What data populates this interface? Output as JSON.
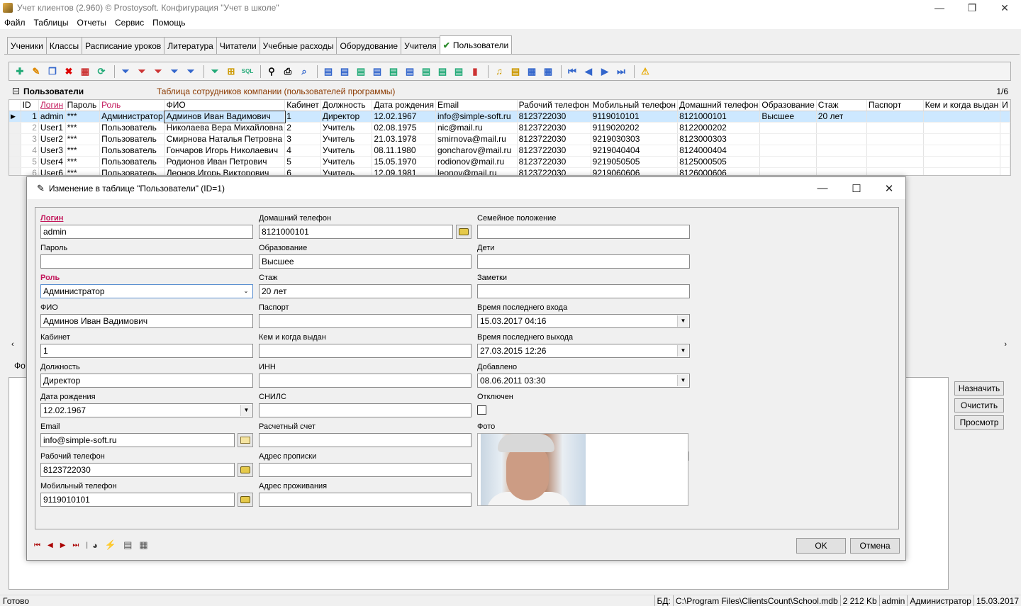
{
  "window": {
    "title": "Учет клиентов (2.960) © Prostoysoft. Конфигурация \"Учет в школе\"",
    "minimize": "—",
    "restore": "❐",
    "close": "✕"
  },
  "menu": [
    "Файл",
    "Таблицы",
    "Отчеты",
    "Сервис",
    "Помощь"
  ],
  "tabs": [
    "Ученики",
    "Классы",
    "Расписание уроков",
    "Литература",
    "Читатели",
    "Учебные расходы",
    "Оборудование",
    "Учителя",
    "Пользователи"
  ],
  "active_tab": "Пользователи",
  "grid": {
    "title": "Пользователи",
    "description": "Таблица сотрудников компании (пользователей программы)",
    "count": "1/6",
    "columns": [
      "ID",
      "Логин",
      "Пароль",
      "Роль",
      "ФИО",
      "Кабинет",
      "Должность",
      "Дата рождения",
      "Email",
      "Рабочий телефон",
      "Мобильный телефон",
      "Домашний телефон",
      "Образование",
      "Стаж",
      "Паспорт",
      "Кем и когда выдан",
      "И"
    ],
    "rows": [
      [
        "1",
        "admin",
        "***",
        "Администратор",
        "Админов Иван Вадимович",
        "1",
        "Директор",
        "12.02.1967",
        "info@simple-soft.ru",
        "8123722030",
        "9119010101",
        "8121000101",
        "Высшее",
        "20 лет",
        "",
        "",
        ""
      ],
      [
        "2",
        "User1",
        "***",
        "Пользователь",
        "Николаева Вера Михайловна",
        "2",
        "Учитель",
        "02.08.1975",
        "nic@mail.ru",
        "8123722030",
        "9119020202",
        "8122000202",
        "",
        "",
        "",
        "",
        ""
      ],
      [
        "3",
        "User2",
        "***",
        "Пользователь",
        "Смирнова Наталья Петровна",
        "3",
        "Учитель",
        "21.03.1978",
        "smirnova@mail.ru",
        "8123722030",
        "9219030303",
        "8123000303",
        "",
        "",
        "",
        "",
        ""
      ],
      [
        "4",
        "User3",
        "***",
        "Пользователь",
        "Гончаров Игорь Николаевич",
        "4",
        "Учитель",
        "08.11.1980",
        "goncharov@mail.ru",
        "8123722030",
        "9219040404",
        "8124000404",
        "",
        "",
        "",
        "",
        ""
      ],
      [
        "5",
        "User4",
        "***",
        "Пользователь",
        "Родионов Иван Петрович",
        "5",
        "Учитель",
        "15.05.1970",
        "rodionov@mail.ru",
        "8123722030",
        "9219050505",
        "8125000505",
        "",
        "",
        "",
        "",
        ""
      ],
      [
        "6",
        "User6",
        "***",
        "Пользователь",
        "Леонов Игорь Викторович",
        "6",
        "Учитель",
        "12.09.1981",
        "leonov@mail.ru",
        "8123722030",
        "9219060606",
        "8126000606",
        "",
        "",
        "",
        "",
        ""
      ]
    ]
  },
  "lower": {
    "tab_label": "Фо",
    "buttons": [
      "Назначить",
      "Очистить",
      "Просмотр"
    ]
  },
  "dialog": {
    "title": "Изменение в таблице \"Пользователи\" (ID=1)",
    "fields": {
      "login": {
        "label": "Логин",
        "value": "admin"
      },
      "password": {
        "label": "Пароль",
        "value": ""
      },
      "role": {
        "label": "Роль",
        "value": "Администратор"
      },
      "fio": {
        "label": "ФИО",
        "value": "Админов Иван Вадимович"
      },
      "cabinet": {
        "label": "Кабинет",
        "value": "1"
      },
      "position": {
        "label": "Должность",
        "value": "Директор"
      },
      "birth": {
        "label": "Дата рождения",
        "value": "12.02.1967"
      },
      "email": {
        "label": "Email",
        "value": "info@simple-soft.ru"
      },
      "work_phone": {
        "label": "Рабочий телефон",
        "value": "8123722030"
      },
      "mobile": {
        "label": "Мобильный телефон",
        "value": "9119010101"
      },
      "home_phone": {
        "label": "Домашний телефон",
        "value": "8121000101"
      },
      "education": {
        "label": "Образование",
        "value": "Высшее"
      },
      "experience": {
        "label": "Стаж",
        "value": "20 лет"
      },
      "passport": {
        "label": "Паспорт",
        "value": ""
      },
      "issued": {
        "label": "Кем и когда выдан",
        "value": ""
      },
      "inn": {
        "label": "ИНН",
        "value": ""
      },
      "snils": {
        "label": "СНИЛС",
        "value": ""
      },
      "account": {
        "label": "Расчетный счет",
        "value": ""
      },
      "reg_address": {
        "label": "Адрес прописки",
        "value": ""
      },
      "live_address": {
        "label": "Адрес проживания",
        "value": ""
      },
      "marital": {
        "label": "Семейное положение",
        "value": ""
      },
      "children": {
        "label": "Дети",
        "value": ""
      },
      "notes": {
        "label": "Заметки",
        "value": ""
      },
      "last_login": {
        "label": "Время последнего входа",
        "value": "15.03.2017 04:16"
      },
      "last_logout": {
        "label": "Время последнего выхода",
        "value": "27.03.2015 12:26"
      },
      "added": {
        "label": "Добавлено",
        "value": "08.06.2011 03:30"
      },
      "disabled": {
        "label": "Отключен",
        "checked": false
      },
      "photo": {
        "label": "Фото"
      }
    },
    "ok": "OK",
    "cancel": "Отмена"
  },
  "status": {
    "ready": "Готово",
    "db_label": "БД:",
    "db_path": "C:\\Program Files\\ClientsCount\\School.mdb",
    "size": "2 212 Kb",
    "user": "admin",
    "role": "Администратор",
    "date": "15.03.2017"
  },
  "colors": {
    "accent_red": "#c2185b",
    "selection": "#cde8ff",
    "desc_brown": "#8b3a00"
  }
}
